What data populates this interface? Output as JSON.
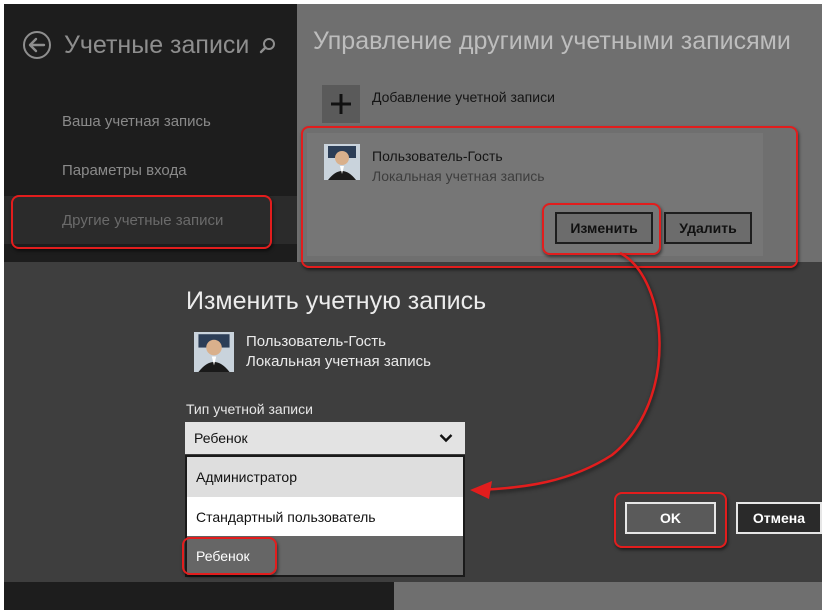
{
  "sidebar": {
    "title": "Учетные записи",
    "back_icon": "back-arrow-icon",
    "search_icon": "search-icon",
    "items": [
      {
        "label": "Ваша учетная запись"
      },
      {
        "label": "Параметры входа"
      },
      {
        "label": "Другие учетные записи",
        "selected": true
      }
    ]
  },
  "main": {
    "title": "Управление другими учетными записями",
    "add_account": {
      "label": "Добавление учетной записи",
      "icon": "plus-icon"
    },
    "account": {
      "name": "Пользователь-Гость",
      "type": "Локальная учетная запись",
      "avatar_icon": "user-avatar-icon",
      "edit_label": "Изменить",
      "delete_label": "Удалить"
    }
  },
  "dialog": {
    "title": "Изменить учетную запись",
    "account": {
      "name": "Пользователь-Гость",
      "type": "Локальная учетная запись"
    },
    "account_type_label": "Тип учетной записи",
    "selected_type": "Ребенок",
    "options": [
      "Администратор",
      "Стандартный пользователь",
      "Ребенок"
    ],
    "ok_label": "OK",
    "cancel_label": "Отмена"
  },
  "annotations": {
    "highlight_color": "#e21d1d"
  },
  "colors": {
    "left_pane": "#1d1d1d",
    "right_pane": "#6f6f6f",
    "dialog": "#3e3e3e"
  }
}
